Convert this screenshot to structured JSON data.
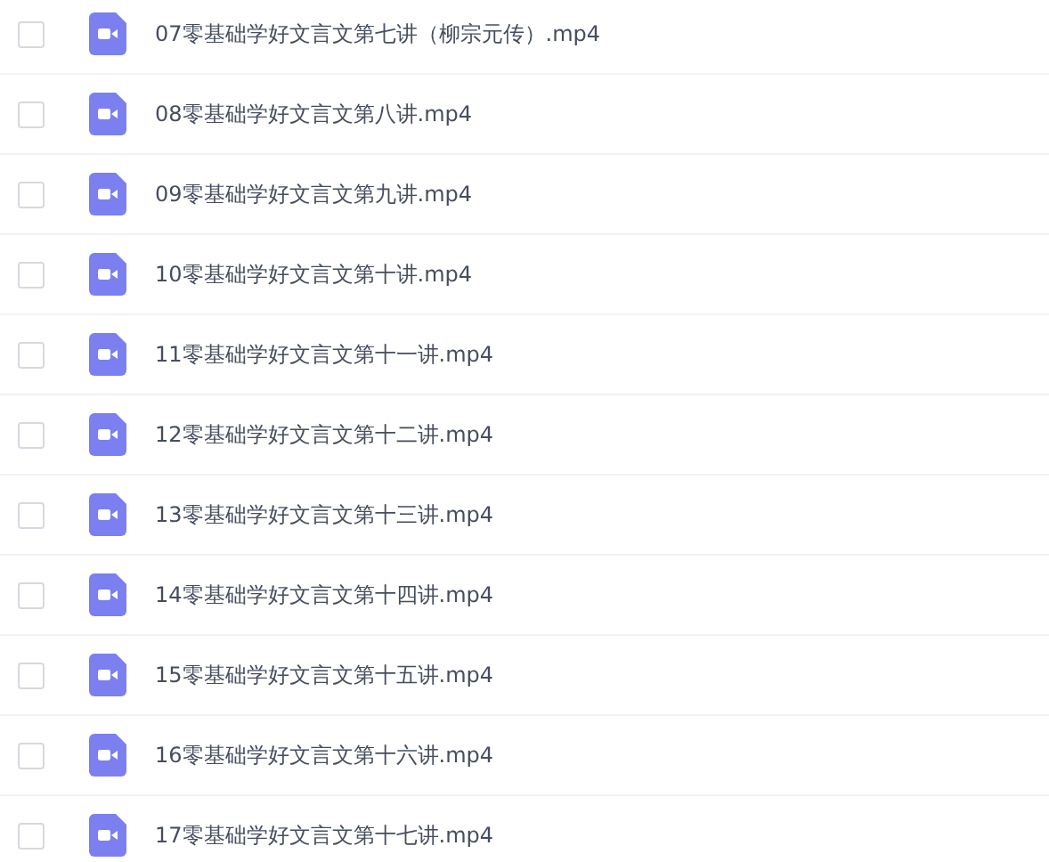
{
  "files": [
    {
      "name": "07零基础学好文言文第七讲（柳宗元传）.mp4",
      "checked": false
    },
    {
      "name": "08零基础学好文言文第八讲.mp4",
      "checked": false
    },
    {
      "name": "09零基础学好文言文第九讲.mp4",
      "checked": false
    },
    {
      "name": "10零基础学好文言文第十讲.mp4",
      "checked": false
    },
    {
      "name": "11零基础学好文言文第十一讲.mp4",
      "checked": false
    },
    {
      "name": "12零基础学好文言文第十二讲.mp4",
      "checked": false
    },
    {
      "name": "13零基础学好文言文第十三讲.mp4",
      "checked": false
    },
    {
      "name": "14零基础学好文言文第十四讲.mp4",
      "checked": false
    },
    {
      "name": "15零基础学好文言文第十五讲.mp4",
      "checked": false
    },
    {
      "name": "16零基础学好文言文第十六讲.mp4",
      "checked": false
    },
    {
      "name": "17零基础学好文言文第十七讲.mp4",
      "checked": false
    }
  ]
}
